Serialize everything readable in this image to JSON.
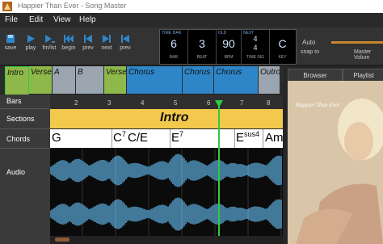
{
  "window": {
    "title": "Happier Than Ever - Song Master"
  },
  "menu": {
    "file": "File",
    "edit": "Edit",
    "view": "View",
    "help": "Help"
  },
  "toolbar": {
    "save": "save",
    "play": "play",
    "loop": "fm/lst",
    "begin": "begin",
    "prev": "prev",
    "next": "next",
    "prev2": "prev"
  },
  "display": {
    "time_label": "TIME",
    "bar_label_top": "BAR",
    "bar": "6",
    "bar_label": "BAR",
    "beat": "3",
    "beat_label": "BEAT",
    "bpm_top": "OLD",
    "bpm": "90",
    "bpm_label": "BPM",
    "timesig_top": "NEXT",
    "timesig_num": "4",
    "timesig_den": "4",
    "timesig_label": "TIME SIG",
    "key": "C",
    "key_label": "KEY"
  },
  "auto": {
    "label": "Auto",
    "snap": "snap to",
    "volume": "Master Volum"
  },
  "overview": {
    "segments": [
      "Intro",
      "Verse",
      "A",
      "B",
      "Verse",
      "Chorus",
      "Chorus",
      "Chorus",
      "Outro"
    ]
  },
  "tabs": {
    "browser": "Browser",
    "playlist": "Playlist"
  },
  "album": {
    "script": "Happier Than Ever"
  },
  "tracks": {
    "bars": "Bars",
    "sections": "Sections",
    "chords": "Chords",
    "audio": "Audio"
  },
  "ruler": {
    "ticks": [
      "2",
      "3",
      "4",
      "5",
      "6",
      "7",
      "8"
    ]
  },
  "section_name": "Intro",
  "chords": [
    {
      "root": "G",
      "ext": ""
    },
    {
      "root": "C",
      "ext": "7"
    },
    {
      "root": "C/E",
      "ext": ""
    },
    {
      "root": "E",
      "ext": "7"
    },
    {
      "root": "E",
      "ext": "sus4"
    },
    {
      "root": "Am",
      "ext": ""
    }
  ],
  "colors": {
    "section": "#f2c94c",
    "wave": "#5aa8d6",
    "playhead": "#2ecc40",
    "accent": "#2f86c9"
  }
}
